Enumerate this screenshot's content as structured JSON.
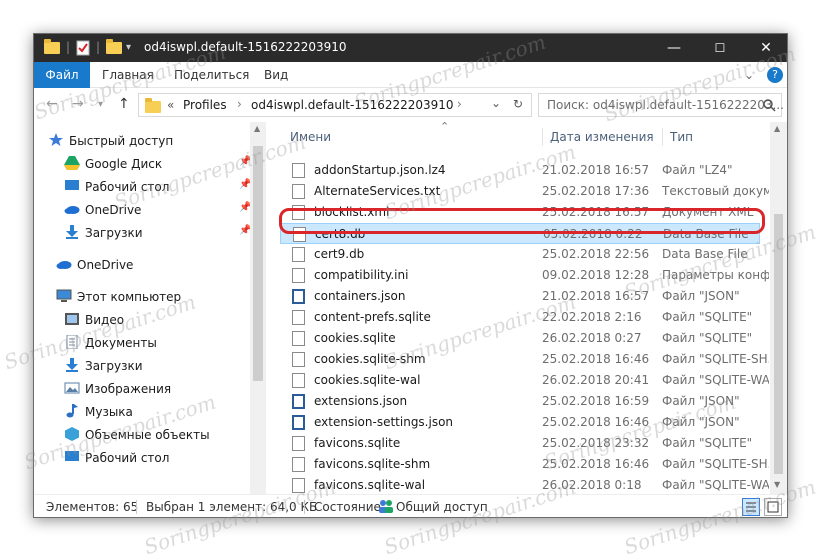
{
  "window": {
    "title": "od4iswpl.default-1516222203910",
    "minimize": "—",
    "maximize": "☐",
    "close": "✕"
  },
  "ribbon": {
    "tabs": [
      "Файл",
      "Главная",
      "Поделиться",
      "Вид"
    ],
    "collapse_glyph": "⌄",
    "help_glyph": "?"
  },
  "address": {
    "prefix": "«",
    "crumbs": [
      "Profiles",
      "od4iswpl.default-1516222203910"
    ],
    "separator": "›",
    "dropdown_glyph": "⌄",
    "refresh_glyph": "↻"
  },
  "search": {
    "placeholder": "Поиск: od4iswpl.default-1516222203..."
  },
  "sidebar": {
    "items": [
      {
        "label": "Быстрый доступ",
        "icon": "star-icon",
        "color": "#3d7bd9",
        "pinned": false
      },
      {
        "label": "Google Диск",
        "icon": "google-drive-icon",
        "color": "#1da462",
        "pinned": true
      },
      {
        "label": "Рабочий стол",
        "icon": "desktop-icon",
        "color": "#2b7fd1",
        "pinned": true
      },
      {
        "label": "OneDrive",
        "icon": "cloud-icon",
        "color": "#1e6fd1",
        "pinned": true
      },
      {
        "label": "Загрузки",
        "icon": "download-icon",
        "color": "#2b7fd1",
        "pinned": true
      },
      {
        "label": "OneDrive",
        "icon": "cloud-icon",
        "color": "#1e6fd1",
        "pinned": false
      },
      {
        "label": "Этот компьютер",
        "icon": "computer-icon",
        "color": "#3b8ad8",
        "pinned": false
      },
      {
        "label": "Видео",
        "icon": "video-icon",
        "color": "#555555",
        "pinned": false
      },
      {
        "label": "Документы",
        "icon": "documents-icon",
        "color": "#7a8fa6",
        "pinned": false
      },
      {
        "label": "Загрузки",
        "icon": "download-icon",
        "color": "#2b7fd1",
        "pinned": false
      },
      {
        "label": "Изображения",
        "icon": "pictures-icon",
        "color": "#5a7fa6",
        "pinned": false
      },
      {
        "label": "Музыка",
        "icon": "music-icon",
        "color": "#2b6fc4",
        "pinned": false
      },
      {
        "label": "Объемные объекты",
        "icon": "3d-objects-icon",
        "color": "#3aa0d8",
        "pinned": false
      },
      {
        "label": "Рабочий стол",
        "icon": "desktop-icon",
        "color": "#2b7fd1",
        "pinned": false
      }
    ]
  },
  "columns": {
    "name": "Имени",
    "date": "Дата изменения",
    "type": "Тип"
  },
  "files": [
    {
      "name": "addonStartup.json.lz4",
      "date": "21.02.2018 16:57",
      "type": "Файл \"LZ4\"",
      "icon": "file-icon"
    },
    {
      "name": "AlternateServices.txt",
      "date": "25.02.2018 17:36",
      "type": "Текстовый докум...",
      "icon": "text-file-icon"
    },
    {
      "name": "blocklist.xml",
      "date": "25.02.2018 16:57",
      "type": "Документ XML",
      "icon": "file-icon"
    },
    {
      "name": "cert8.db",
      "date": "05.02.2018 0:22",
      "type": "Data Base File",
      "icon": "db-file-icon"
    },
    {
      "name": "cert9.db",
      "date": "25.02.2018 22:56",
      "type": "Data Base File",
      "icon": "db-file-icon"
    },
    {
      "name": "compatibility.ini",
      "date": "09.02.2018 12:28",
      "type": "Параметры конф...",
      "icon": "ini-file-icon"
    },
    {
      "name": "containers.json",
      "date": "21.02.2018 16:57",
      "type": "Файл \"JSON\"",
      "icon": "json-file-icon"
    },
    {
      "name": "content-prefs.sqlite",
      "date": "22.02.2018 2:16",
      "type": "Файл \"SQLITE\"",
      "icon": "file-icon"
    },
    {
      "name": "cookies.sqlite",
      "date": "26.02.2018 0:27",
      "type": "Файл \"SQLITE\"",
      "icon": "file-icon"
    },
    {
      "name": "cookies.sqlite-shm",
      "date": "25.02.2018 16:46",
      "type": "Файл \"SQLITE-SH...",
      "icon": "file-icon"
    },
    {
      "name": "cookies.sqlite-wal",
      "date": "26.02.2018 20:41",
      "type": "Файл \"SQLITE-WA...",
      "icon": "file-icon"
    },
    {
      "name": "extensions.json",
      "date": "25.02.2018 16:59",
      "type": "Файл \"JSON\"",
      "icon": "json-file-icon"
    },
    {
      "name": "extension-settings.json",
      "date": "25.02.2018 16:46",
      "type": "Файл \"JSON\"",
      "icon": "json-file-icon"
    },
    {
      "name": "favicons.sqlite",
      "date": "25.02.2018 23:32",
      "type": "Файл \"SQLITE\"",
      "icon": "file-icon"
    },
    {
      "name": "favicons.sqlite-shm",
      "date": "25.02.2018 16:46",
      "type": "Файл \"SQLITE-SH...",
      "icon": "file-icon"
    },
    {
      "name": "favicons.sqlite-wal",
      "date": "26.02.2018 0:18",
      "type": "Файл \"SQLITE-WA...",
      "icon": "file-icon"
    }
  ],
  "selected_index": 3,
  "status": {
    "count": "Элементов: 65",
    "selected": "Выбран 1 элемент: 64,0 КБ",
    "state": "Состояние:",
    "sharing": "Общий доступ"
  },
  "watermark": "Soringpcrepair.com",
  "colors": {
    "accent": "#1979ca",
    "titlebar": "#2b2b2b",
    "highlight": "#d9262a",
    "selection": "#cce8ff"
  }
}
